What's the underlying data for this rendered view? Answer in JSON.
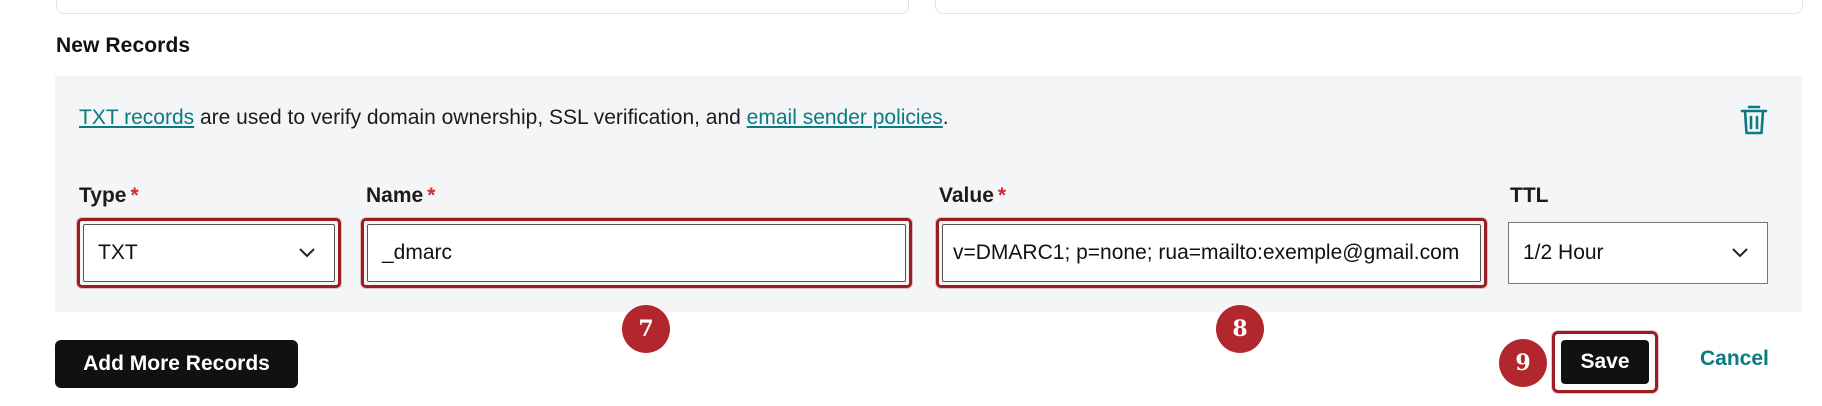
{
  "section": {
    "title": "New Records"
  },
  "info": {
    "link1": "TXT records",
    "middle": " are used to verify domain ownership, SSL verification, and ",
    "link2": "email sender policies",
    "end": "."
  },
  "fields": {
    "type": {
      "label": "Type",
      "required": "*",
      "value": "TXT"
    },
    "name": {
      "label": "Name",
      "required": "*",
      "value": "_dmarc"
    },
    "value": {
      "label": "Value",
      "required": "*",
      "value": "v=DMARC1; p=none; rua=mailto:exemple@gmail.com"
    },
    "ttl": {
      "label": "TTL",
      "value": "1/2 Hour"
    }
  },
  "annotations": {
    "step7": "7",
    "step8": "8",
    "step9": "9"
  },
  "buttons": {
    "add_more": "Add More Records",
    "save": "Save",
    "cancel": "Cancel"
  },
  "colors": {
    "accent": "#0a7b82",
    "annotation": "#b1272d",
    "required": "#d22c2c"
  },
  "icons": {
    "delete": "trash-icon",
    "dropdown": "chevron-down-icon"
  }
}
